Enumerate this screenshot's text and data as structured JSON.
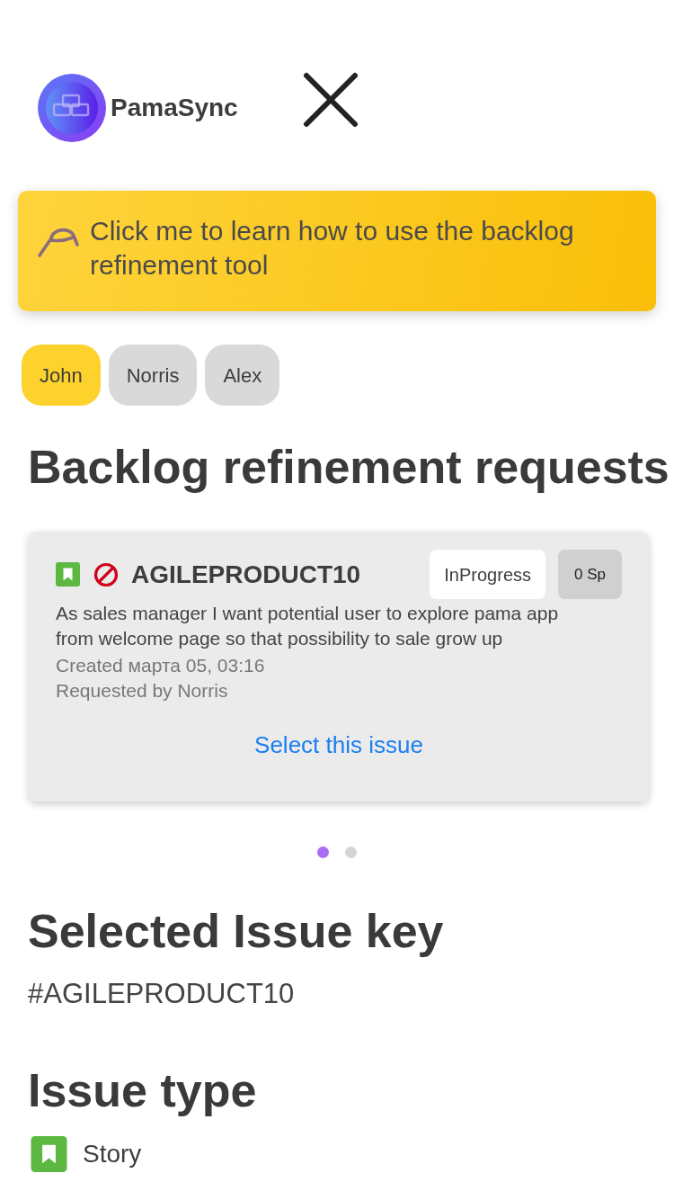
{
  "header": {
    "brand": "PamaSync"
  },
  "help_banner": {
    "text": "Click me to learn how to use the backlog refinement tool"
  },
  "user_filters": [
    {
      "label": "John",
      "selected": true
    },
    {
      "label": "Norris",
      "selected": false
    },
    {
      "label": "Alex",
      "selected": false
    }
  ],
  "requests": {
    "title": "Backlog refinement requests",
    "issues": [
      {
        "kind": "story",
        "blocked": true,
        "key": "AGILEPRODUCT10",
        "status": "InProgress",
        "points": "0 Sp",
        "summary": "As sales manager I want potential user to explore pama app from welcome page so that possibility to sale grow up",
        "created": "Created марта 05, 03:16",
        "requested_by": "Requested by Norris",
        "action": "Select this issue"
      }
    ],
    "pages": [
      {
        "selected": true
      },
      {
        "selected": false
      }
    ]
  },
  "selected_issue": {
    "title": "Selected Issue key",
    "value": "#AGILEPRODUCT10"
  },
  "issue_type": {
    "title": "Issue type",
    "value": {
      "kind": "story",
      "label": "Story"
    }
  }
}
